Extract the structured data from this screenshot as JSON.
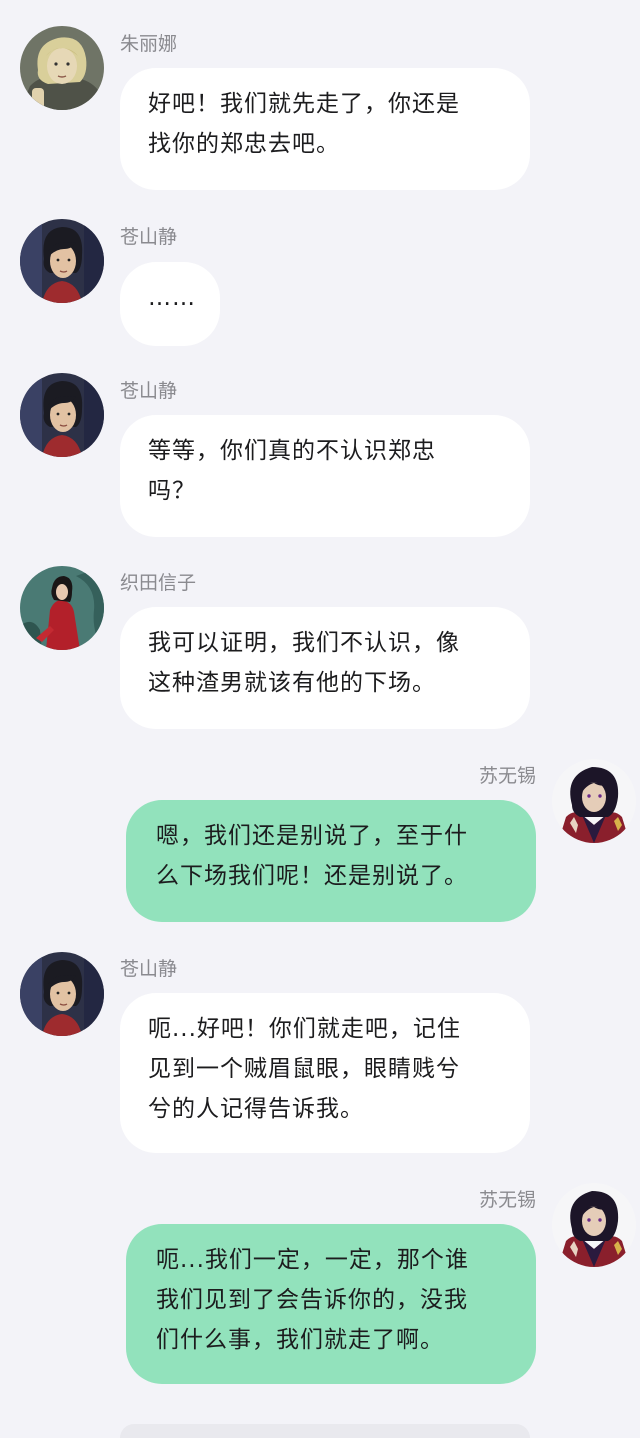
{
  "messages": [
    {
      "sender": "朱丽娜",
      "side": "left",
      "avatar": "blonde-woman-avatar-icon",
      "lines": [
        "好吧！我们就先走了，你还是",
        "找你的郑忠去吧。"
      ]
    },
    {
      "sender": "苍山静",
      "side": "left",
      "avatar": "dark-hair-man-avatar-icon",
      "lines": [
        "……"
      ]
    },
    {
      "sender": "苍山静",
      "side": "left",
      "avatar": "dark-hair-man-avatar-icon",
      "lines": [
        "等等，你们真的不认识郑忠",
        "吗？"
      ]
    },
    {
      "sender": "织田信子",
      "side": "left",
      "avatar": "red-dress-woman-avatar-icon",
      "lines": [
        "我可以证明，我们不认识，像",
        "这种渣男就该有他的下场。"
      ]
    },
    {
      "sender": "苏无锡",
      "side": "right",
      "avatar": "caped-man-avatar-icon",
      "lines": [
        "嗯，我们还是别说了，至于什",
        "么下场我们呢！还是别说了。"
      ]
    },
    {
      "sender": "苍山静",
      "side": "left",
      "avatar": "dark-hair-man-avatar-icon",
      "lines": [
        "呃...好吧！你们就走吧，记住",
        "见到一个贼眉鼠眼，眼睛贱兮",
        "兮的人记得告诉我。"
      ]
    },
    {
      "sender": "苏无锡",
      "side": "right",
      "avatar": "caped-man-avatar-icon",
      "lines": [
        "呃...我们一定，一定，那个谁",
        "我们见到了会告诉你的，没我",
        "们什么事，我们就走了啊。"
      ]
    }
  ],
  "colors": {
    "background": "#f3f3f8",
    "incoming_bubble": "#ffffff",
    "outgoing_bubble": "#92e2bc",
    "sender_name": "#8a8a8f"
  }
}
